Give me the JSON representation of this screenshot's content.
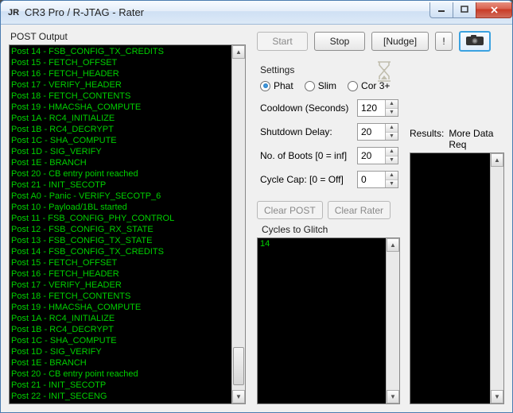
{
  "window": {
    "title": "CR3 Pro / R-JTAG - Rater",
    "icon_text": "JR"
  },
  "buttons": {
    "start": "Start",
    "stop": "Stop",
    "nudge": "[Nudge]",
    "bang": "!",
    "clear_post": "Clear POST",
    "clear_rater": "Clear Rater"
  },
  "labels": {
    "post_output": "POST Output",
    "settings": "Settings",
    "cooldown": "Cooldown (Seconds)",
    "shutdown": "Shutdown Delay:",
    "boots": "No. of Boots [0 = inf]",
    "cap": "Cycle Cap:   [0 = Off]",
    "cycles": "Cycles to Glitch",
    "results": "Results:",
    "results_status": "More Data Req"
  },
  "radios": {
    "phat": "Phat",
    "slim": "Slim",
    "cor3": "Cor 3+",
    "selected": "phat"
  },
  "fields": {
    "cooldown": "120",
    "shutdown": "20",
    "boots": "20",
    "cap": "0"
  },
  "cycles_list": [
    "14"
  ],
  "post_lines": [
    "Post 14 - FSB_CONFIG_TX_CREDITS",
    "Post 15 - FETCH_OFFSET",
    "Post 16 - FETCH_HEADER",
    "Post 17 - VERIFY_HEADER",
    "Post 18 - FETCH_CONTENTS",
    "Post 19 - HMACSHA_COMPUTE",
    "Post 1A - RC4_INITIALIZE",
    "Post 1B - RC4_DECRYPT",
    "Post 1C - SHA_COMPUTE",
    "Post 1D - SIG_VERIFY",
    "Post 1E - BRANCH",
    "Post 20 - CB entry point reached",
    "Post 21 - INIT_SECOTP",
    "Post A0 - Panic - VERIFY_SECOTP_6",
    "Post 10 - Payload/1BL started",
    "Post 11 - FSB_CONFIG_PHY_CONTROL",
    "Post 12 - FSB_CONFIG_RX_STATE",
    "Post 13 - FSB_CONFIG_TX_STATE",
    "Post 14 - FSB_CONFIG_TX_CREDITS",
    "Post 15 - FETCH_OFFSET",
    "Post 16 - FETCH_HEADER",
    "Post 17 - VERIFY_HEADER",
    "Post 18 - FETCH_CONTENTS",
    "Post 19 - HMACSHA_COMPUTE",
    "Post 1A - RC4_INITIALIZE",
    "Post 1B - RC4_DECRYPT",
    "Post 1C - SHA_COMPUTE",
    "Post 1D - SIG_VERIFY",
    "Post 1E - BRANCH",
    "Post 20 - CB entry point reached",
    "Post 21 - INIT_SECOTP",
    "Post 22 - INIT_SECENG"
  ]
}
